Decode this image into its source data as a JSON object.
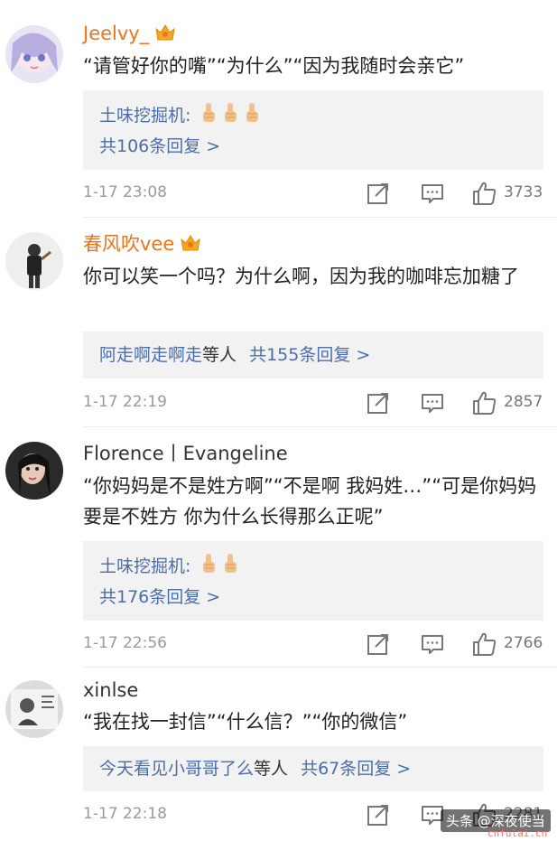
{
  "comments": [
    {
      "username": "Jeelvy_",
      "text": "“请管好你的嘴”“为什么”“因为我随时会亲它”",
      "reply_user": "土味挖掘机:",
      "reply_count": "共106条回复 >",
      "time": "1-17 23:08",
      "likes": "3733"
    },
    {
      "username": "春风吹vee",
      "text": "你可以笑一个吗？为什么啊，因为我的咖啡忘加糖了",
      "reply_users": "阿走啊走啊走",
      "reply_etc": "等人",
      "reply_count": "共155条回复 >",
      "time": "1-17 22:19",
      "likes": "2857"
    },
    {
      "username": "Florence丨Evangeline",
      "text": "“你妈妈是不是姓方啊”“不是啊 我妈姓…”“可是你妈妈要是不姓方 你为什么长得那么正呢”",
      "reply_user": "土味挖掘机:",
      "reply_count": "共176条回复 >",
      "time": "1-17 22:56",
      "likes": "2766"
    },
    {
      "username": "xinlse",
      "text": "“我在找一封信”“什么信？”“你的微信”",
      "reply_users": "今天看见小哥哥了么",
      "reply_etc": "等人",
      "reply_count": "共67条回复 >",
      "time": "1-17 22:18",
      "likes": "2281"
    }
  ],
  "watermark": {
    "text": "头条 @深夜使当",
    "site": "cnfulai.cn"
  },
  "colors": {
    "username_orange": "#e8761e",
    "link_blue": "#4b6ea8",
    "reply_bg": "#f2f2f2"
  }
}
